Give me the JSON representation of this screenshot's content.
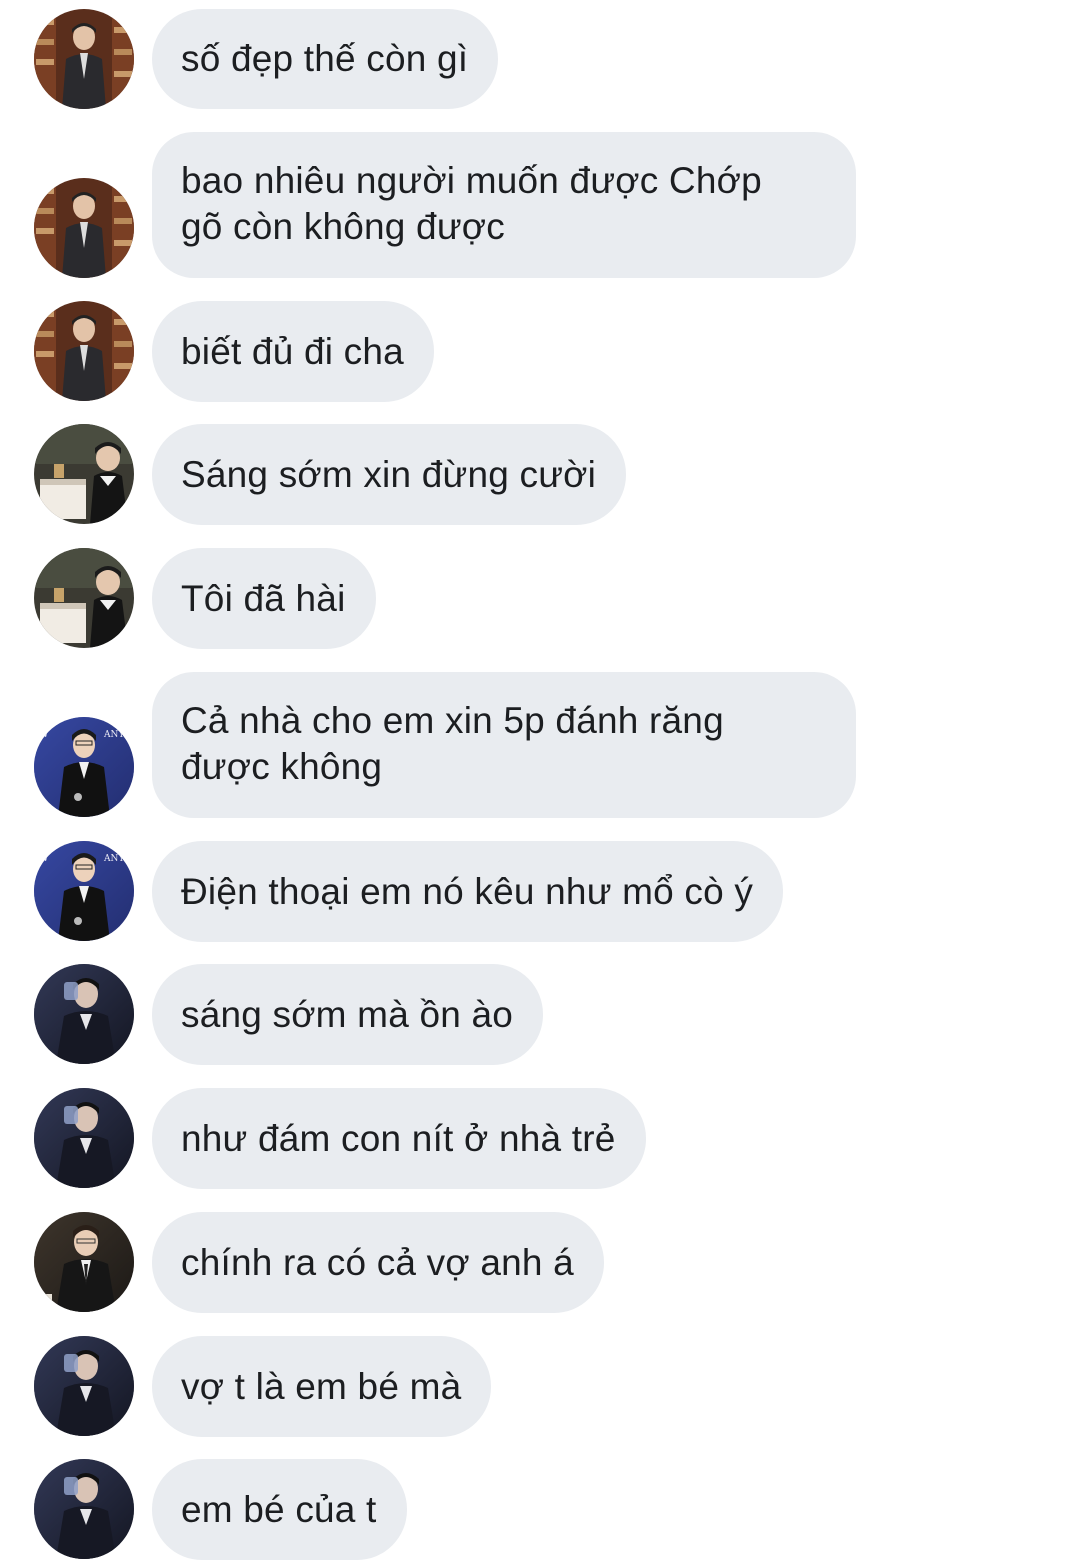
{
  "messages": [
    {
      "text": "số đẹp thế còn gì",
      "avatar": "avatar-a"
    },
    {
      "text": "bao nhiêu người muốn được Chớp\ngõ còn không được",
      "avatar": "avatar-a"
    },
    {
      "text": "biết đủ đi cha",
      "avatar": "avatar-a"
    },
    {
      "text": "Sáng sớm xin đừng cười",
      "avatar": "avatar-b"
    },
    {
      "text": "Tôi đã hài",
      "avatar": "avatar-b"
    },
    {
      "text": "Cả nhà cho em xin 5p đánh răng\nđược không",
      "avatar": "avatar-c"
    },
    {
      "text": "Điện thoại em nó kêu như mổ cò ý",
      "avatar": "avatar-c"
    },
    {
      "text": "sáng sớm mà ồn ào",
      "avatar": "avatar-d"
    },
    {
      "text": "như đám con nít ở nhà trẻ",
      "avatar": "avatar-d"
    },
    {
      "text": "chính ra có cả vợ anh á",
      "avatar": "avatar-e"
    },
    {
      "text": "vợ t là em bé mà",
      "avatar": "avatar-d"
    },
    {
      "text": "em bé của t",
      "avatar": "avatar-d"
    }
  ],
  "avatar_style": {
    "avatar-a": "dark suited person, bookshelves",
    "avatar-b": "person at piano, warm room",
    "avatar-c": "person in suit with microphone, blue backdrop",
    "avatar-d": "person drinking, dark blue scene",
    "avatar-e": "person in suit and tie, dark room"
  },
  "colors": {
    "bubble": "#e9ecf0",
    "text": "#1c1e21",
    "background": "#ffffff"
  }
}
